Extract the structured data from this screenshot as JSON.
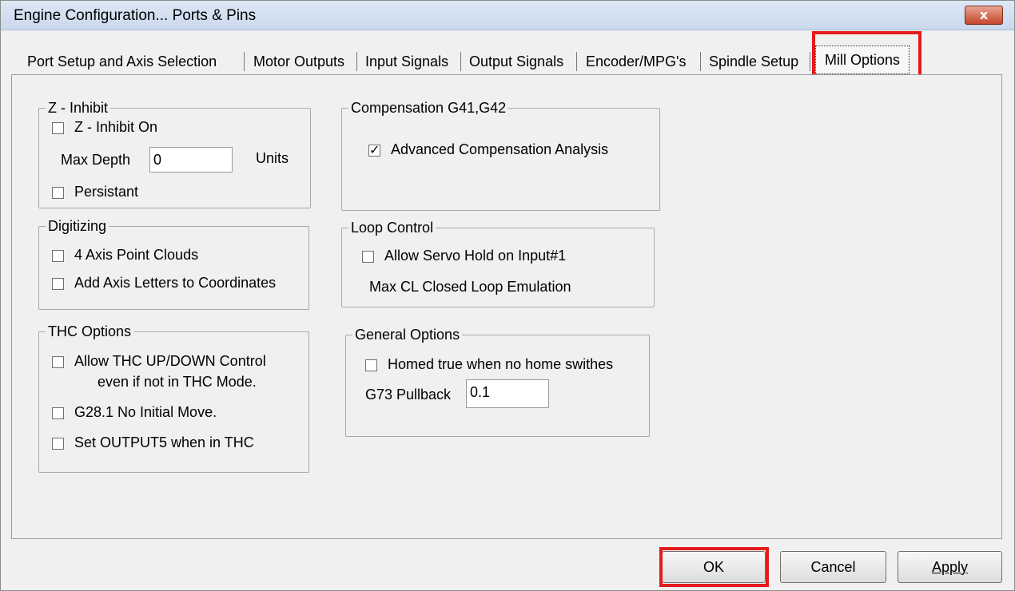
{
  "window": {
    "title": "Engine Configuration... Ports & Pins",
    "close_label": "x"
  },
  "tabs": [
    {
      "label": "Port Setup and Axis Selection"
    },
    {
      "label": "Motor Outputs"
    },
    {
      "label": "Input Signals"
    },
    {
      "label": "Output Signals"
    },
    {
      "label": "Encoder/MPG's"
    },
    {
      "label": "Spindle Setup"
    },
    {
      "label": "Mill Options",
      "active": true
    }
  ],
  "z_inhibit": {
    "legend": "Z - Inhibit",
    "inhibit_on": {
      "label": "Z - Inhibit On",
      "checked": false
    },
    "max_depth_label": "Max Depth",
    "max_depth_value": "0",
    "units_label": "Units",
    "persistant": {
      "label": "Persistant",
      "checked": false
    }
  },
  "digitizing": {
    "legend": "Digitizing",
    "point_clouds": {
      "label": "4 Axis Point Clouds",
      "checked": false
    },
    "axis_letters": {
      "label": "Add Axis Letters to Coordinates",
      "checked": false
    }
  },
  "thc_options": {
    "legend": "THC Options",
    "updown": {
      "label_line1": "Allow THC UP/DOWN Control",
      "label_line2": "even if not in THC Mode.",
      "checked": false
    },
    "g28": {
      "label": "G28.1 No Initial Move.",
      "checked": false
    },
    "output5": {
      "label": "Set OUTPUT5 when in THC",
      "checked": false
    }
  },
  "compensation": {
    "legend": "Compensation G41,G42",
    "advanced": {
      "label": "Advanced Compensation Analysis",
      "checked": true,
      "mark": "✓"
    }
  },
  "loop_control": {
    "legend": "Loop Control",
    "servo_hold": {
      "label": "Allow Servo Hold on Input#1",
      "checked": false
    },
    "max_cl_label": "Max CL Closed Loop Emulation"
  },
  "general_options": {
    "legend": "General Options",
    "homed": {
      "label": "Homed true when no home swithes",
      "checked": false
    },
    "pullback_label": "G73 Pullback",
    "pullback_value": "0.1"
  },
  "buttons": {
    "ok": "OK",
    "cancel": "Cancel",
    "apply": "Apply"
  },
  "colors": {
    "highlight": "#e31b1b",
    "close_button": "#c4472b",
    "titlebar": "#c9d8ec"
  }
}
